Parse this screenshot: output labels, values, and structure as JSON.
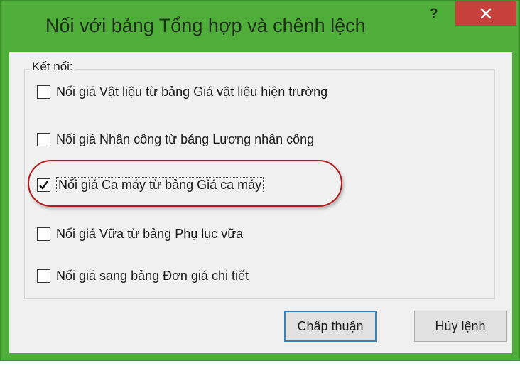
{
  "window": {
    "title": "Nối với bảng Tổng hợp và chênh lệch",
    "help_label": "?",
    "close_icon": "close-icon",
    "frame_color": "#4fae3a",
    "close_color": "#c7403b"
  },
  "group": {
    "label": "Kết nối:"
  },
  "options": [
    {
      "label": "Nối giá Vật liệu từ bảng Giá vật liệu hiện trường",
      "checked": false
    },
    {
      "label": "Nối giá Nhân công từ bảng Lương nhân công",
      "checked": false
    },
    {
      "label": "Nối giá Ca máy từ bảng Giá ca máy",
      "checked": true
    },
    {
      "label": "Nối giá Vữa từ bảng Phụ lục vữa",
      "checked": false
    },
    {
      "label": "Nối giá sang bảng Đơn giá chi tiết",
      "checked": false
    }
  ],
  "buttons": {
    "ok_label": "Chấp thuận",
    "cancel_label": "Hủy lệnh"
  },
  "annotation": {
    "highlight_color": "#b51b1b"
  }
}
